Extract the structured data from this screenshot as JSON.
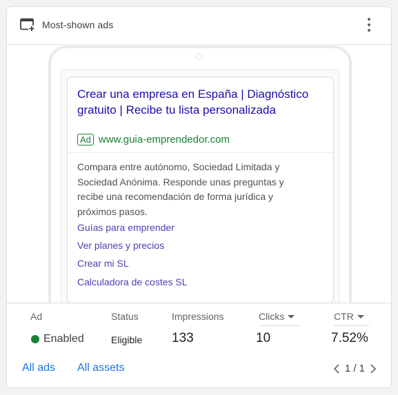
{
  "header": {
    "title": "Most-shown ads",
    "icon": "add-to-card-icon",
    "menu_icon": "more-vert-icon"
  },
  "ad": {
    "headline": "Crear una empresa en España | Diagnóstico gratuito | Recibe tu lista personalizada",
    "badge": "Ad",
    "display_url": "www.guia-emprendedor.com",
    "description": "Compara entre autónomo, Sociedad Limitada y Sociedad Anónima. Responde unas preguntas y recibe una recomendación de forma jurídica y próximos pasos.",
    "sitelinks": [
      "Guías para emprender",
      "Ver planes y precios",
      "Crear mi SL",
      "Calculadora de costes SL"
    ]
  },
  "stats": {
    "columns": {
      "ad": "Ad",
      "status": "Status",
      "impressions": "Impressions",
      "clicks": "Clicks",
      "ctr": "CTR"
    },
    "row": {
      "ad_status": "Enabled",
      "status": "Eligible",
      "impressions": "133",
      "clicks": "10",
      "ctr": "7.52%"
    }
  },
  "footer": {
    "all_ads": "All ads",
    "all_assets": "All assets",
    "pager": "1 / 1"
  },
  "colors": {
    "accent": "#1a73e8",
    "headline": "#1a0dab",
    "url_green": "#188038",
    "enabled_dot": "#188038",
    "sitelink": "#4b3fb4"
  }
}
